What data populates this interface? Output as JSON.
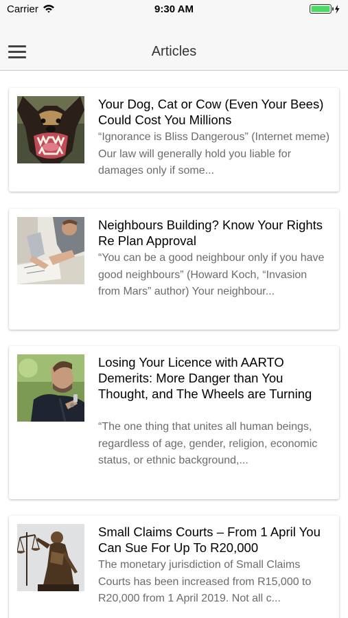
{
  "status": {
    "carrier": "Carrier",
    "time": "9:30 AM"
  },
  "header": {
    "title": "Articles",
    "menu_icon": "hamburger-menu-icon"
  },
  "articles": [
    {
      "title": "Your Dog, Cat or Cow (Even Your Bees) Could Cost You Millions",
      "excerpt": "“Ignorance is Bliss Dangerous” (Internet meme) Our law will generally hold you liable for damages only if some...",
      "thumbnail": "snarling-dog"
    },
    {
      "title": "Neighbours Building? Know Your Rights Re Plan Approval",
      "excerpt": "“You can be a good neighbour only if you have good neighbours” (Howard Koch, “Invasion from Mars” author) Your neighbour...",
      "thumbnail": "people-reviewing-plans"
    },
    {
      "title": "Losing Your Licence with AARTO Demerits: More Danger than You Thought, and The Wheels are Turning",
      "excerpt": "“The one thing that unites all human beings, regardless of age, gender, religion, economic status, or ethnic background,...",
      "thumbnail": "man-holding-car-keys"
    },
    {
      "title": "Small Claims Courts – From 1 April You Can Sue For Up To R20,000",
      "excerpt": "The monetary jurisdiction of Small Claims Courts has been increased from R15,000 to R20,000 from 1 April 2019. Not all c...",
      "thumbnail": "lady-justice-statue"
    }
  ]
}
